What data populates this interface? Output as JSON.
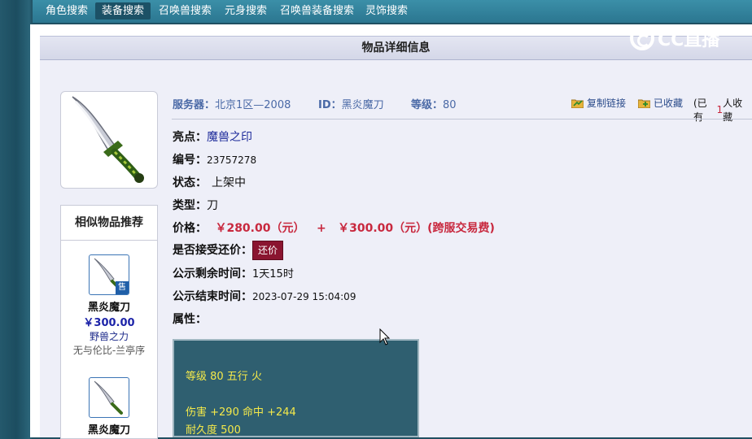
{
  "nav": {
    "tabs": [
      {
        "label": "角色搜索"
      },
      {
        "label": "装备搜索"
      },
      {
        "label": "召唤兽搜索"
      },
      {
        "label": "元身搜索"
      },
      {
        "label": "召唤兽装备搜索"
      },
      {
        "label": "灵饰搜索"
      }
    ],
    "active_index": 1
  },
  "logo": {
    "text": "CC直播"
  },
  "panel": {
    "title": "物品详细信息"
  },
  "item": {
    "server_label": "服务器：",
    "server_value": "北京1区—2008",
    "id_label": "ID：",
    "id_value": "黑炎魔刀",
    "level_label": "等级：",
    "level_value": "80",
    "copy_link": "复制链接",
    "favorited": "已收藏",
    "favorite_count_prefix": "(已有",
    "favorite_count": "1",
    "favorite_count_suffix": "人收藏",
    "highlight_label": "亮点：",
    "highlight_value": "魔兽之印",
    "number_label": "编号：",
    "number_value": "23757278",
    "status_label": "状态：",
    "status_value": "上架中",
    "type_label": "类型：",
    "type_value": "刀",
    "price_label": "价格：",
    "price_value": "￥280.00（元）",
    "price_plus": "+",
    "price_fee": "￥300.00（元）(跨服交易费)",
    "counter_label": "是否接受还价：",
    "counter_button": "还价",
    "remaining_label": "公示剩余时间：",
    "remaining_value": "1天15时",
    "end_label": "公示结束时间：",
    "end_value": "2023-07-29 15:04:09",
    "attr_label": "属性：",
    "attributes": {
      "line1": "等级 80 五行 火",
      "line2": "伤害 +290 命中 +244",
      "line3": "耐久度 500"
    }
  },
  "similar": {
    "title": "相似物品推荐",
    "items": [
      {
        "name": "黑炎魔刀",
        "price": "￥300.00",
        "server": "野兽之力",
        "seller": "无与伦比-兰亭序",
        "badge": "售"
      },
      {
        "name": "黑炎魔刀",
        "badge": ""
      }
    ]
  },
  "colors": {
    "accent_nav": "#2b7690",
    "price_red": "#c8283e",
    "attr_bg": "#2f5f70",
    "attr_text": "#f4e94a"
  }
}
